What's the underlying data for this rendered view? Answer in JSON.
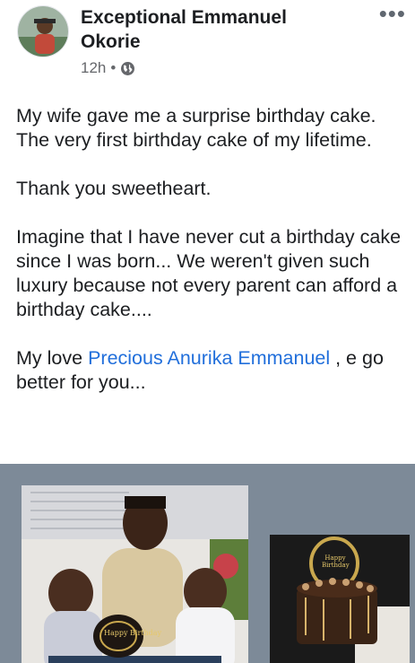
{
  "post": {
    "author": "Exceptional Emmanuel Okorie",
    "time": "12h",
    "separator": "•",
    "audience_icon": "globe-icon",
    "more_icon": "more-options-icon",
    "more_glyph": "•••",
    "paragraphs": {
      "p1": "My wife gave me a surprise birthday cake. The very first birthday cake of my lifetime.",
      "p2": "Thank you sweetheart.",
      "p3": "Imagine that I have never cut a birthday cake since I was born... We weren't given such luxury because not every parent can afford a birthday cake....",
      "p4_prefix": "My love ",
      "p4_mention": "Precious Anurika Emmanuel",
      "p4_suffix": " , e go better for you..."
    },
    "photos": {
      "cake1_text": "Happy Birthday",
      "cake2_text": "Happy Birthday"
    }
  },
  "colors": {
    "link": "#216fdb",
    "meta": "#65676b",
    "media_bg": "#7d8a98"
  }
}
